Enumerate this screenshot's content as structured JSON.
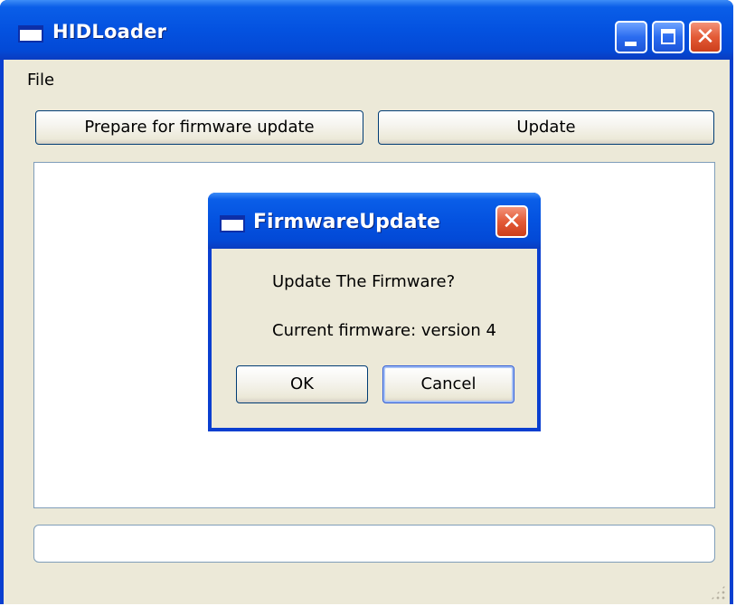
{
  "window": {
    "title": "HIDLoader",
    "buttons": {
      "minimize": "minimize-icon",
      "maximize": "maximize-icon",
      "close": "close-icon"
    }
  },
  "menubar": {
    "items": [
      "File"
    ]
  },
  "toolbar": {
    "prepare_label": "Prepare for firmware update",
    "update_label": "Update"
  },
  "dialog": {
    "title": "FirmwareUpdate",
    "question": "Update The Firmware?",
    "version_text": "Current firmware: version 4",
    "ok_label": "OK",
    "cancel_label": "Cancel"
  },
  "status": {
    "value": ""
  },
  "colors": {
    "titlebar": "#0452e0",
    "window_bg": "#ece9d8",
    "close_red": "#e35a36"
  }
}
